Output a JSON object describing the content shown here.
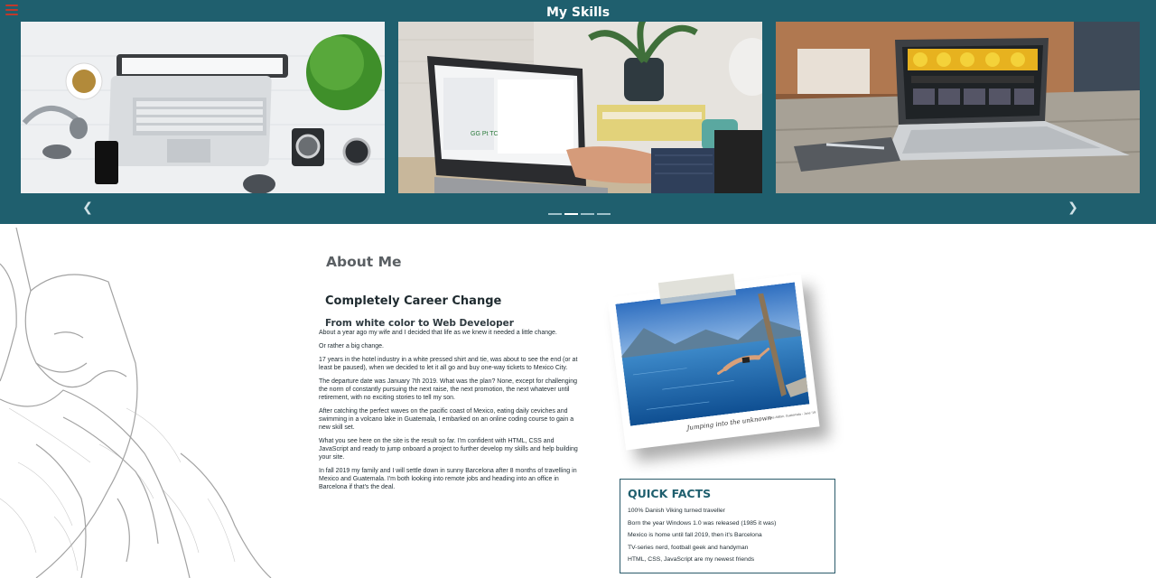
{
  "header": {
    "title": "My Skills",
    "menu_icon": "hamburger-menu-icon",
    "background": "#1f5f6e",
    "menu_color": "#c0392b"
  },
  "carousel": {
    "slides": [
      {
        "alt": "laptop-desk-flatlay"
      },
      {
        "alt": "hands-typing-laptop"
      },
      {
        "alt": "laptop-on-wooden-table"
      }
    ],
    "prev_icon": "chevron-left-icon",
    "next_icon": "chevron-right-icon",
    "prev_glyph": "❮",
    "next_glyph": "❯",
    "indicator_count": 4,
    "active_indicator": 2
  },
  "about": {
    "heading": "About Me",
    "subheading": "Completely Career Change",
    "tagline": "From white color to Web Developer",
    "paragraphs": [
      "About a year ago my wife and I decided that life as we knew it needed a little change.",
      "Or rather a big change.",
      "17 years in the hotel industry in a white pressed shirt and tie, was about to see the end (or at least be paused), when we decided to let it all go and buy one-way tickets to Mexico City.",
      "The departure date was January 7th 2019. What was the plan? None, except for challenging the norm of constantly pursuing the next raise, the next promotion, the next whatever until retirement, with no exciting stories to tell my son.",
      "After catching the perfect waves on the pacific coast of Mexico, eating daily ceviches and swimming in a volcano lake in Guatemala, I embarked on an online coding course to gain a new skill set.",
      "What you see here on the site is the result so far. I'm confident with HTML, CSS and JavaScript and ready to jump onboard a project to further develop my skills and help building your site.",
      "In fall 2019 my family and I will settle down in sunny Barcelona after 8 months of travelling in Mexico and Guatemala. I'm both looking into remote jobs and heading into an office in Barcelona if that's the deal."
    ]
  },
  "polaroid": {
    "caption": "Jumping into the unknown",
    "small_caption": "Lake Atitlan, Guatemala - June '19"
  },
  "quick_facts": {
    "title": "QUICK FACTS",
    "items": [
      "100% Danish Viking turned traveller",
      "Born the year Windows 1.0 was released (1985 it was)",
      "Mexico is home until fall 2019, then it's Barcelona",
      "TV-series nerd, football geek and handyman",
      "HTML, CSS, JavaScript are my newest friends"
    ]
  }
}
